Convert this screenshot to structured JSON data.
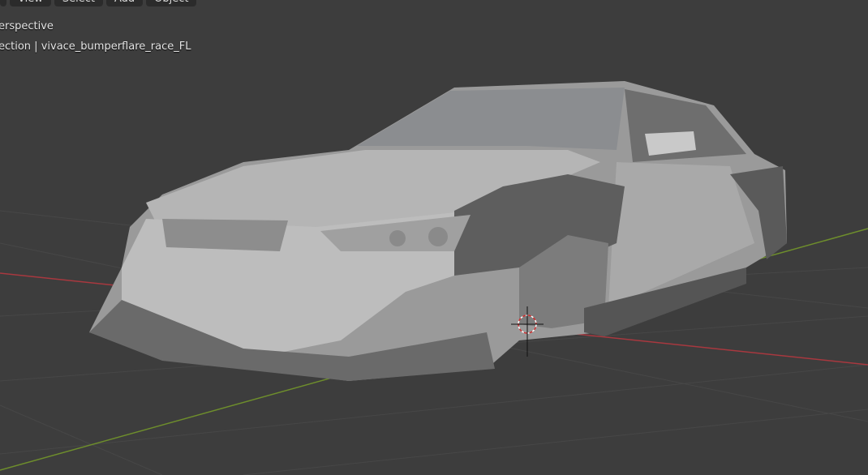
{
  "header": {
    "menu": [
      {
        "label": ""
      },
      {
        "label": "View"
      },
      {
        "label": "Select"
      },
      {
        "label": "Add"
      },
      {
        "label": "Object"
      }
    ]
  },
  "overlay": {
    "view_mode": "erspective",
    "collection_info": "ection | vivace_bumperflare_race_FL"
  },
  "colors": {
    "background": "#3d3d3d",
    "x_axis": "#a8383f",
    "y_axis": "#6e8e2c",
    "grid": "#484848"
  }
}
